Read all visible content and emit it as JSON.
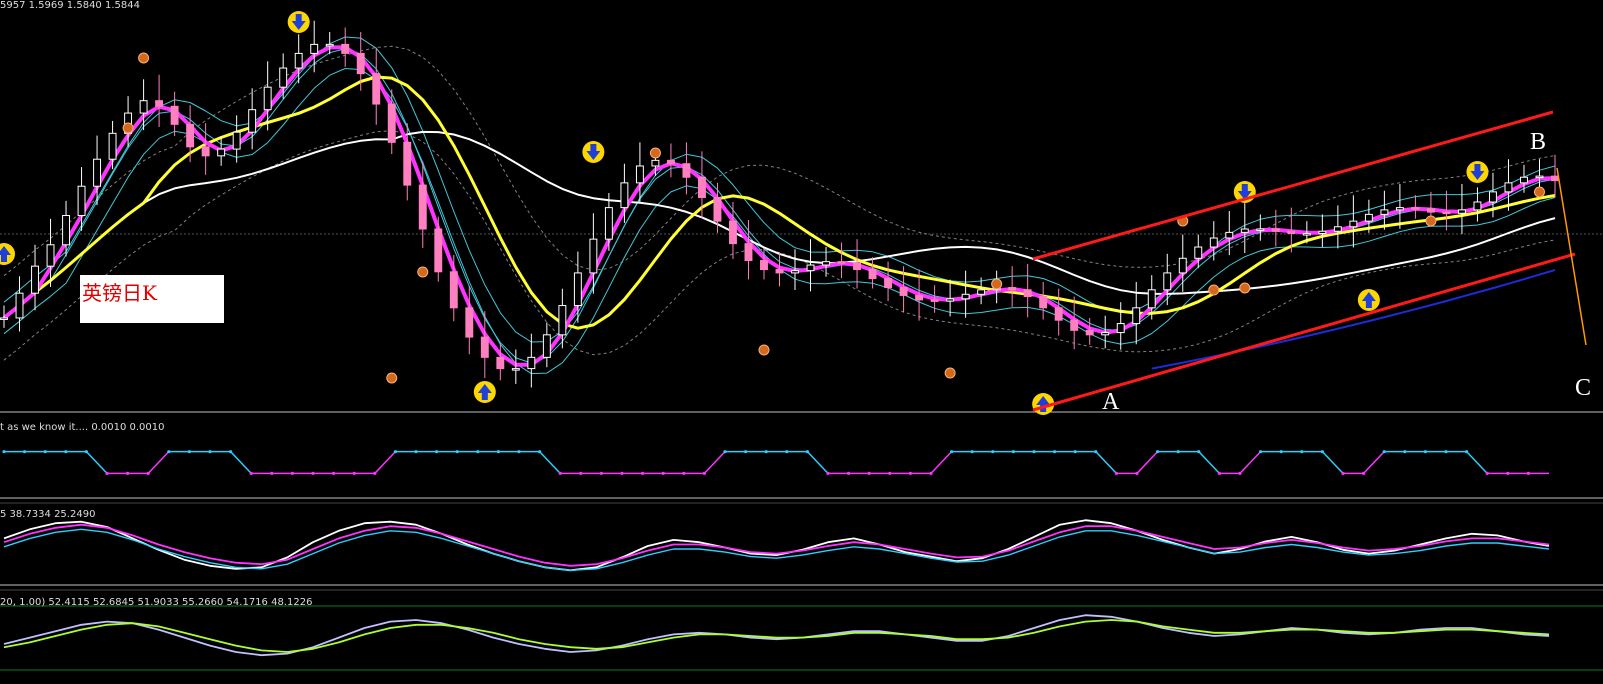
{
  "main_header": "5957 1.5969 1.5840 1.5844",
  "title": "英镑日K",
  "point_labels": {
    "a": "A",
    "b": "B",
    "c": "C"
  },
  "panels": {
    "p1_header": "t as we know it.... 0.0010 0.0010",
    "p2_header": "5 38.7334 25.2490",
    "p3_header": "20, 1.00) 52.4115 52.6845 51.9033 55.2660 54.1716 48.1226"
  },
  "colors": {
    "bull_candle": "#ffffff",
    "bear_candle": "#ff80c0",
    "ma_fast": "#ff33ff",
    "ma_mid": "#ffff33",
    "ma_slow": "#ffffff",
    "envelope": "#40c8d8",
    "bands": "#808080",
    "channel": "#ff1a1a",
    "long_ma": "#1e2bd8",
    "signal_up": "#2ad0ff",
    "signal_down": "#ff33ff"
  },
  "chart_data": [
    {
      "type": "candlestick",
      "name": "main",
      "instrument_label": "英镑日K",
      "header": "5957 1.5969 1.5840 1.5844",
      "close": [
        1.556,
        1.5604,
        1.5652,
        1.569,
        1.5742,
        1.5794,
        1.5842,
        1.5888,
        1.5924,
        1.5946,
        1.5936,
        1.5904,
        1.5864,
        1.5848,
        1.586,
        1.589,
        1.593,
        1.597,
        1.6004,
        1.603,
        1.6046,
        1.6046,
        1.603,
        1.5994,
        1.594,
        1.5872,
        1.5796,
        1.5718,
        1.5642,
        1.5578,
        1.5526,
        1.549,
        1.547,
        1.547,
        1.549,
        1.553,
        1.5582,
        1.564,
        1.57,
        1.5756,
        1.58,
        1.583,
        1.584,
        1.5834,
        1.581,
        1.5774,
        1.5732,
        1.5692,
        1.5662,
        1.5646,
        1.564,
        1.5644,
        1.5654,
        1.566,
        1.5658,
        1.5646,
        1.563,
        1.5614,
        1.56,
        1.5592,
        1.559,
        1.5594,
        1.5602,
        1.561,
        1.5614,
        1.561,
        1.5598,
        1.5578,
        1.5556,
        1.5538,
        1.553,
        1.5534,
        1.555,
        1.5578,
        1.561,
        1.564,
        1.5666,
        1.5686,
        1.5702,
        1.5712,
        1.5718,
        1.5718,
        1.5714,
        1.571,
        1.571,
        1.5714,
        1.5722,
        1.5732,
        1.5744,
        1.5752,
        1.5756,
        1.5754,
        1.5748,
        1.5746,
        1.5752,
        1.5766,
        1.5784,
        1.58,
        1.581,
        1.5812,
        1.5804
      ],
      "ylim": [
        1.54,
        1.61
      ],
      "overlays": [
        "fast MA",
        "mid MA",
        "slow MA",
        "envelope",
        "bollinger bands",
        "channel lines"
      ]
    },
    {
      "type": "line",
      "name": "panel-1-step",
      "header": "t as we know it.... 0.0010 0.0010",
      "values": [
        1,
        1,
        1,
        1,
        1,
        0,
        0,
        0,
        1,
        1,
        1,
        1,
        0,
        0,
        0,
        0,
        0,
        0,
        0,
        1,
        1,
        1,
        1,
        1,
        1,
        1,
        1,
        0,
        0,
        0,
        0,
        0,
        0,
        0,
        0,
        1,
        1,
        1,
        1,
        1,
        0,
        0,
        0,
        0,
        0,
        0,
        1,
        1,
        1,
        1,
        1,
        1,
        1,
        1,
        0,
        0,
        1,
        1,
        1,
        0,
        0,
        1,
        1,
        1,
        1,
        0,
        0,
        1,
        1,
        1,
        1,
        1,
        0,
        0,
        0,
        0
      ],
      "ylim": [
        -1,
        2
      ]
    },
    {
      "type": "line",
      "name": "panel-2-oscillator",
      "header": "5 38.7334 25.2490",
      "series": [
        {
          "values": [
            60,
            72,
            80,
            82,
            75,
            60,
            45,
            32,
            24,
            20,
            22,
            35,
            55,
            70,
            80,
            82,
            78,
            66,
            52,
            40,
            30,
            22,
            18,
            22,
            35,
            50,
            58,
            55,
            48,
            40,
            38,
            45,
            55,
            60,
            52,
            42,
            36,
            30,
            34,
            46,
            62,
            78,
            84,
            80,
            70,
            58,
            48,
            40,
            46,
            56,
            62,
            55,
            45,
            40,
            44,
            52,
            60,
            66,
            64,
            56,
            50
          ]
        },
        {
          "values": [
            55,
            66,
            74,
            78,
            74,
            64,
            52,
            42,
            34,
            28,
            26,
            32,
            46,
            60,
            70,
            76,
            74,
            66,
            56,
            46,
            36,
            28,
            24,
            26,
            34,
            44,
            52,
            52,
            48,
            42,
            40,
            44,
            50,
            55,
            52,
            46,
            40,
            35,
            36,
            44,
            56,
            68,
            76,
            76,
            70,
            62,
            54,
            46,
            48,
            54,
            58,
            54,
            48,
            44,
            46,
            50,
            56,
            60,
            60,
            56,
            52
          ]
        }
      ],
      "ylim": [
        0,
        100
      ]
    },
    {
      "type": "line",
      "name": "panel-3-oscillator",
      "header": "20, 1.00) 52.4115 52.6845 51.9033 55.2660 54.1716 48.1226",
      "series": [
        {
          "values": [
            40,
            48,
            56,
            64,
            68,
            66,
            58,
            48,
            38,
            30,
            26,
            28,
            36,
            48,
            60,
            68,
            70,
            66,
            58,
            48,
            40,
            34,
            30,
            32,
            38,
            46,
            52,
            54,
            52,
            48,
            46,
            48,
            52,
            56,
            56,
            52,
            48,
            44,
            44,
            50,
            60,
            70,
            76,
            74,
            68,
            60,
            54,
            50,
            52,
            56,
            60,
            58,
            54,
            52,
            54,
            58,
            60,
            60,
            56,
            52,
            50
          ]
        },
        {
          "values": [
            36,
            42,
            50,
            58,
            64,
            66,
            62,
            54,
            46,
            38,
            32,
            30,
            34,
            42,
            52,
            60,
            64,
            64,
            60,
            54,
            46,
            40,
            36,
            34,
            36,
            42,
            48,
            52,
            52,
            50,
            48,
            48,
            50,
            54,
            54,
            52,
            50,
            46,
            46,
            48,
            54,
            62,
            68,
            70,
            68,
            62,
            58,
            54,
            54,
            56,
            58,
            58,
            56,
            54,
            54,
            56,
            58,
            58,
            56,
            54,
            52
          ]
        }
      ],
      "ylim": [
        0,
        100
      ]
    }
  ]
}
